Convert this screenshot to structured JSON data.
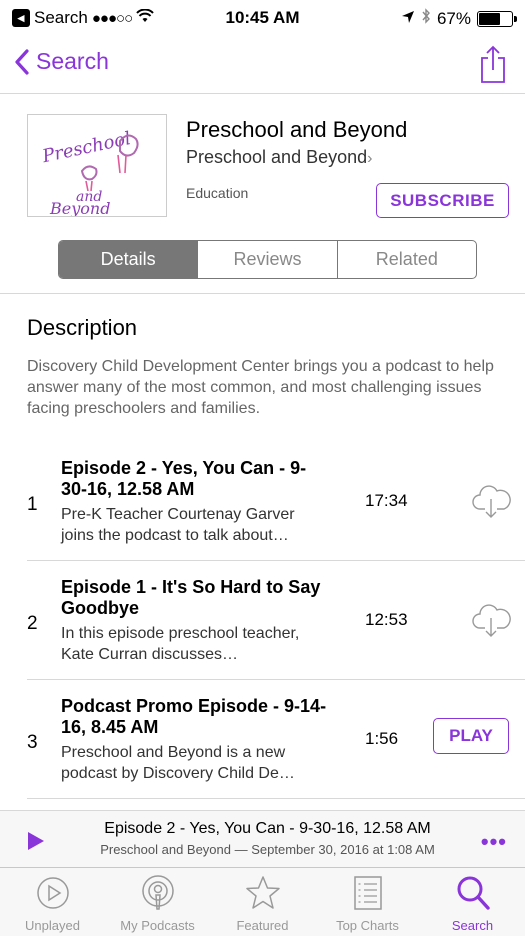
{
  "status_bar": {
    "back_app": "Search",
    "signal": "●●●○○",
    "time": "10:45 AM",
    "battery_percent": "67%",
    "battery_level": 0.67
  },
  "nav": {
    "back_label": "Search",
    "back_icon": "chevron-left-icon",
    "share_icon": "share-icon"
  },
  "podcast": {
    "artwork_text": [
      "Preschool",
      "and",
      "Beyond"
    ],
    "title": "Preschool and Beyond",
    "author": "Preschool and Beyond",
    "author_chevron": "›",
    "genre": "Education",
    "subscribe_label": "SUBSCRIBE"
  },
  "tabs": [
    {
      "label": "Details",
      "active": true
    },
    {
      "label": "Reviews",
      "active": false
    },
    {
      "label": "Related",
      "active": false
    }
  ],
  "description": {
    "heading": "Description",
    "text": "Discovery Child Development Center brings you a podcast to help answer many of the most common, and most challenging issues facing preschoolers and families."
  },
  "episodes": [
    {
      "number": "1",
      "title": "Episode 2 - Yes, You Can - 9-30-16, 12.58 AM",
      "desc": "Pre-K Teacher Courtenay Garver joins the podcast to talk about…",
      "duration": "17:34",
      "action": "download-cloud-icon"
    },
    {
      "number": "2",
      "title": "Episode 1 - It's So Hard to Say Goodbye",
      "desc": "In this episode preschool teacher, Kate Curran discusses…",
      "duration": "12:53",
      "action": "download-cloud-icon"
    },
    {
      "number": "3",
      "title": "Podcast Promo Episode - 9-14-16, 8.45 AM",
      "desc": "Preschool and Beyond is a new podcast by Discovery Child De…",
      "duration": "1:56",
      "action_label": "PLAY"
    }
  ],
  "mini_player": {
    "title": "Episode 2 - Yes, You Can - 9-30-16, 12.58 AM",
    "subtitle": "Preschool and Beyond — September 30, 2016 at 1:08 AM",
    "more": "•••"
  },
  "tab_bar": [
    {
      "label": "Unplayed",
      "icon": "play-circle-icon",
      "active": false
    },
    {
      "label": "My Podcasts",
      "icon": "podcasts-icon",
      "active": false
    },
    {
      "label": "Featured",
      "icon": "star-icon",
      "active": false
    },
    {
      "label": "Top Charts",
      "icon": "list-icon",
      "active": false
    },
    {
      "label": "Search",
      "icon": "search-icon",
      "active": true
    }
  ],
  "colors": {
    "accent": "#8a35d9",
    "segment_active": "#777777",
    "divider": "#d8d8d8"
  }
}
